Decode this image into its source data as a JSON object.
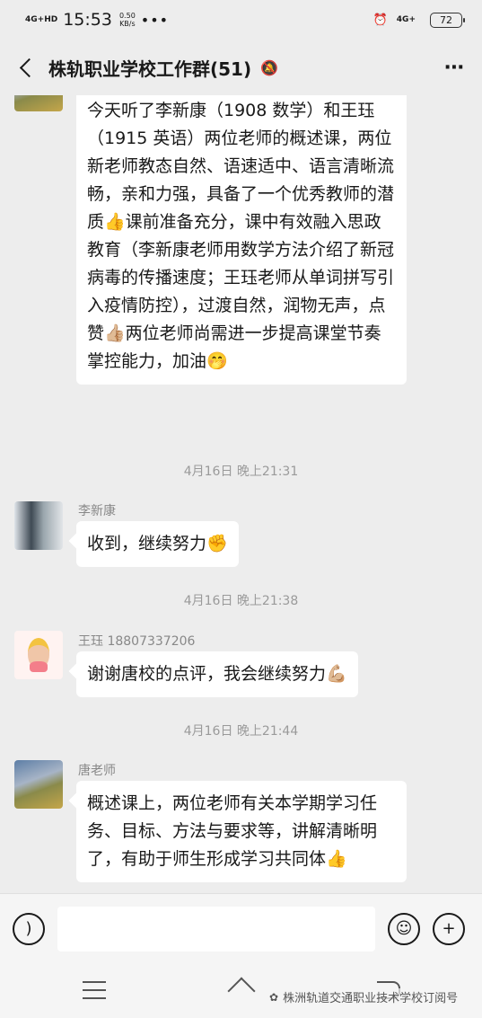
{
  "status_bar": {
    "network": "4G+HD",
    "time": "15:53",
    "speed_value": "0.50",
    "speed_unit": "KB/s",
    "dots": "•••",
    "net_right": "4G+",
    "battery": "72"
  },
  "header": {
    "title": "株轨职业学校工作群(51)"
  },
  "messages": [
    {
      "text": "今天听了李新康（1908 数学）和王珏（1915 英语）两位老师的概述课，两位新老师教态自然、语速适中、语言清晰流畅，亲和力强，具备了一个优秀教师的潜质👍课前准备充分，课中有效融入思政教育（李新康老师用数学方法介绍了新冠病毒的传播速度；王珏老师从单词拼写引入疫情防控），过渡自然，润物无声，点赞👍🏼两位老师尚需进一步提高课堂节奏掌控能力，加油🤭"
    },
    {
      "timestamp": "4月16日 晚上21:31"
    },
    {
      "sender": "李新康",
      "text": "收到，继续努力✊"
    },
    {
      "timestamp": "4月16日 晚上21:38"
    },
    {
      "sender": "王珏 18807337206",
      "text": "谢谢唐校的点评，我会继续努力💪🏼"
    },
    {
      "timestamp": "4月16日 晚上21:44"
    },
    {
      "sender": "唐老师",
      "text": "概述课上，两位老师有关本学期学习任务、目标、方法与要求等，讲解清晰明了，有助于师生形成学习共同体👍"
    }
  ],
  "watermark": "株洲轨道交通职业技术学校订阅号"
}
